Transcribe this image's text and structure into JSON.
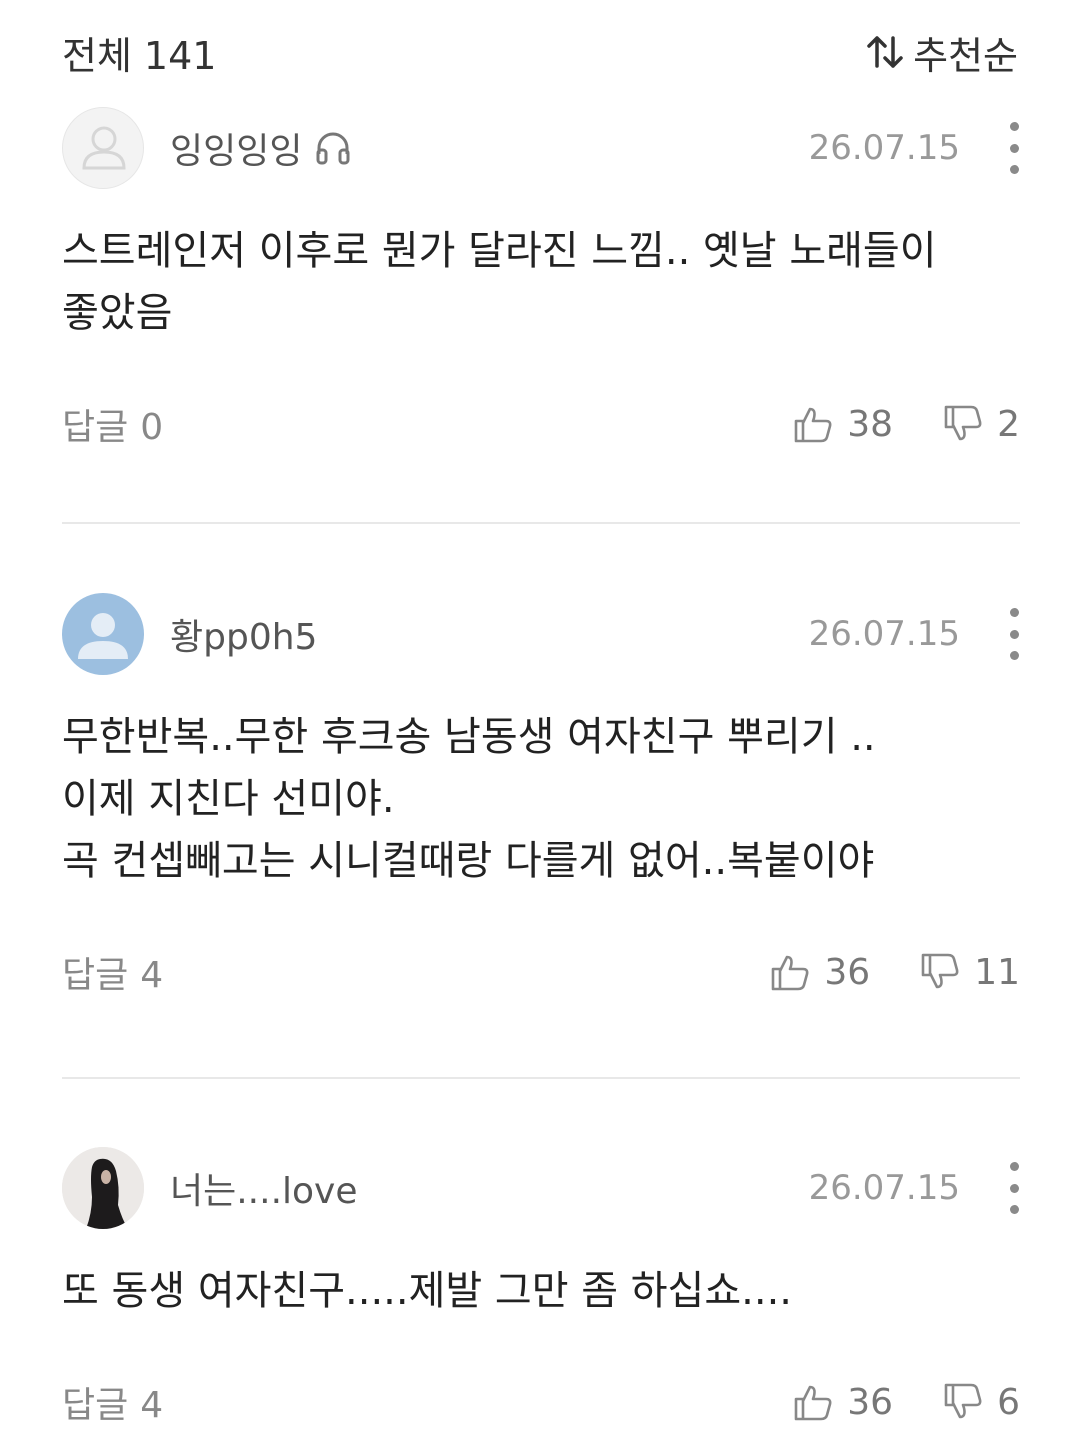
{
  "header": {
    "total_label": "전체",
    "total_count": "141",
    "sort_label": "추천순"
  },
  "comments": [
    {
      "username": "잉잉잉잉",
      "avatar": "default-gray",
      "badge_icon": "headphones-icon",
      "date": "26.07.15",
      "lines": [
        "스트레인저 이후로 뭔가 달라진 느낌.. 옛날 노래들이",
        "좋았음"
      ],
      "reply_label": "답글",
      "reply_count": "0",
      "likes": "38",
      "dislikes": "2"
    },
    {
      "username": "황pp0h5",
      "avatar": "default-blue",
      "date": "26.07.15",
      "lines": [
        "무한반복..무한 후크송 남동생 여자친구 뿌리기 ..",
        "이제 지친다 선미야.",
        "곡 컨셉빼고는 시니컬때랑 다를게 없어..복붙이야"
      ],
      "reply_label": "답글",
      "reply_count": "4",
      "likes": "36",
      "dislikes": "11"
    },
    {
      "username": "너는....love",
      "avatar": "photo",
      "date": "26.07.15",
      "lines": [
        "또 동생 여자친구.....제발 그만 좀 하십쇼...."
      ],
      "reply_label": "답글",
      "reply_count": "4",
      "likes": "36",
      "dislikes": "6"
    }
  ]
}
